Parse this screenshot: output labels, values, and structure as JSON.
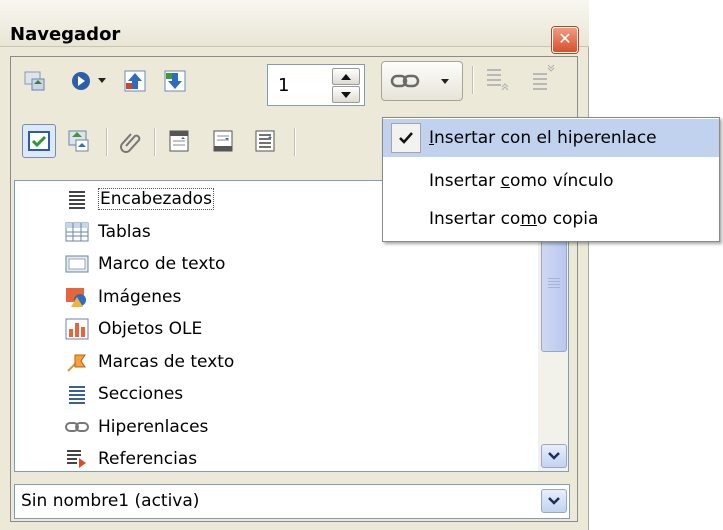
{
  "window": {
    "title": "Navegador",
    "close_glyph": "✕"
  },
  "toolbar1": {
    "page_value": "1",
    "items": [
      "navigation-toggle-icon",
      "navigate-by-icon",
      "dropdown-arrow-icon",
      "previous-arrow-icon",
      "next-arrow-icon",
      "spin-up-icon",
      "spin-down-icon",
      "hyperlink-icon",
      "dropdown-arrow-icon",
      "promote-level-icon",
      "demote-level-icon"
    ]
  },
  "toolbar2": {
    "items": [
      "content-view-icon",
      "set-reminder-icon",
      "attachment-icon",
      "header-icon",
      "footer-icon",
      "anchor-icon"
    ]
  },
  "tree": {
    "items": [
      {
        "label": "Encabezados",
        "icon": "headings-icon"
      },
      {
        "label": "Tablas",
        "icon": "tables-icon"
      },
      {
        "label": "Marco de texto",
        "icon": "text-frame-icon"
      },
      {
        "label": "Imágenes",
        "icon": "images-icon"
      },
      {
        "label": "Objetos OLE",
        "icon": "ole-objects-icon"
      },
      {
        "label": "Marcas de texto",
        "icon": "bookmarks-icon"
      },
      {
        "label": "Secciones",
        "icon": "sections-icon"
      },
      {
        "label": "Hiperenlaces",
        "icon": "hyperlinks-icon"
      },
      {
        "label": "Referencias",
        "icon": "references-icon"
      }
    ]
  },
  "document_select": {
    "value": "Sin nombre1 (activa)"
  },
  "drag_menu": {
    "items": [
      {
        "pre": "",
        "u": "I",
        "post": "nsertar con el hiperenlace",
        "checked": true
      },
      {
        "pre": "Insertar ",
        "u": "c",
        "post": "omo vínculo",
        "checked": false
      },
      {
        "pre": "Insertar co",
        "u": "m",
        "post": "o copia",
        "checked": false
      }
    ]
  },
  "colors": {
    "accent_highlight": "#c1d2ee",
    "close_red": "#d8502b",
    "window_bg": "#ece9d8"
  }
}
